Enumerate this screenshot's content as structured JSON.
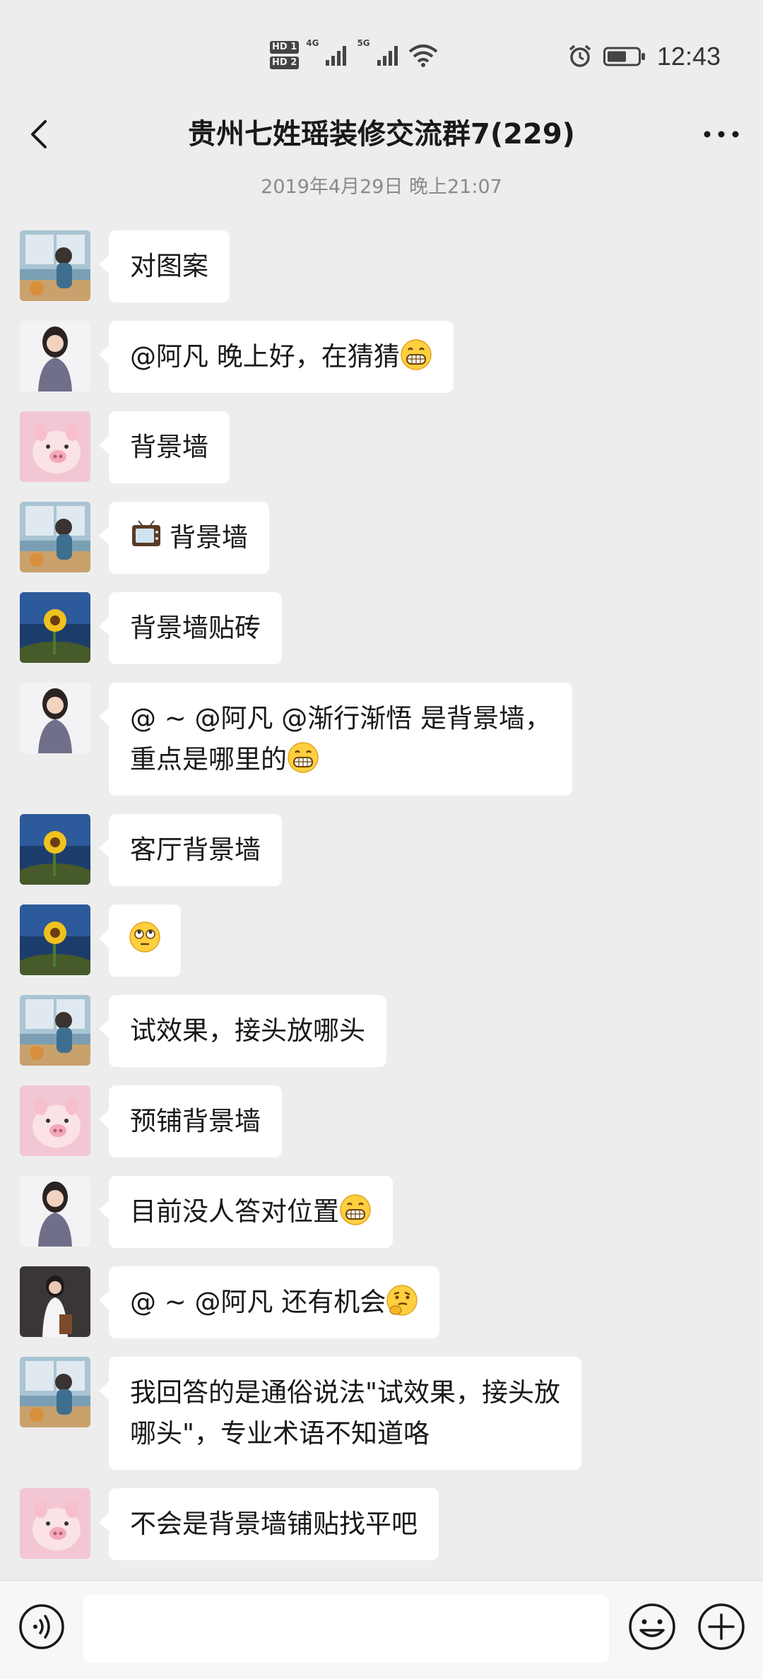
{
  "status_bar": {
    "hd1": "HD 1",
    "hd2": "HD 2",
    "net1": "4G",
    "net2": "5G",
    "time": "12:43",
    "icons": [
      "signal-icon",
      "wifi-icon",
      "alarm-icon",
      "battery-icon"
    ]
  },
  "header": {
    "title": "贵州七姓瑶装修交流群7(229)"
  },
  "timestamp": "2019年4月29日 晚上21:07",
  "messages": [
    {
      "avatar": "avatar-girl-window",
      "text": "对图案"
    },
    {
      "avatar": "avatar-woman-sweater",
      "text": "@阿凡  晚上好，在猜猜",
      "emoji_after": "grin-emoji"
    },
    {
      "avatar": "avatar-pig",
      "text": "背景墙"
    },
    {
      "avatar": "avatar-girl-window",
      "text": "背景墙",
      "emoji_before": "tv-emoji"
    },
    {
      "avatar": "avatar-sunflower",
      "text": "背景墙贴砖"
    },
    {
      "avatar": "avatar-woman-sweater",
      "line1": "@ ~ @阿凡 @渐行渐悟  是背景墙，",
      "line2": "重点是哪里的",
      "emoji_after": "grin-emoji"
    },
    {
      "avatar": "avatar-sunflower",
      "text": "客厅背景墙"
    },
    {
      "avatar": "avatar-sunflower",
      "emoji_only": "eyeroll-emoji"
    },
    {
      "avatar": "avatar-girl-window",
      "text": "试效果，接头放哪头"
    },
    {
      "avatar": "avatar-pig",
      "text": "预铺背景墙"
    },
    {
      "avatar": "avatar-woman-sweater",
      "text": "目前没人答对位置",
      "emoji_after": "grin-emoji"
    },
    {
      "avatar": "avatar-woman-dark",
      "text": "@ ~ @阿凡  还有机会",
      "emoji_after": "thinking-emoji"
    },
    {
      "avatar": "avatar-girl-window",
      "line1": "我回答的是通俗说法\"试效果，接头放",
      "line2": "哪头\"，专业术语不知道咯"
    },
    {
      "avatar": "avatar-pig",
      "text": "不会是背景墙铺贴找平吧"
    }
  ],
  "input_bar": {
    "text_value": "",
    "icons": [
      "voice-icon",
      "emoji-icon",
      "plus-icon"
    ]
  },
  "colors": {
    "background": "#ededed",
    "bubble": "#ffffff",
    "text": "#191919",
    "timestamp": "#8a8a8a"
  }
}
